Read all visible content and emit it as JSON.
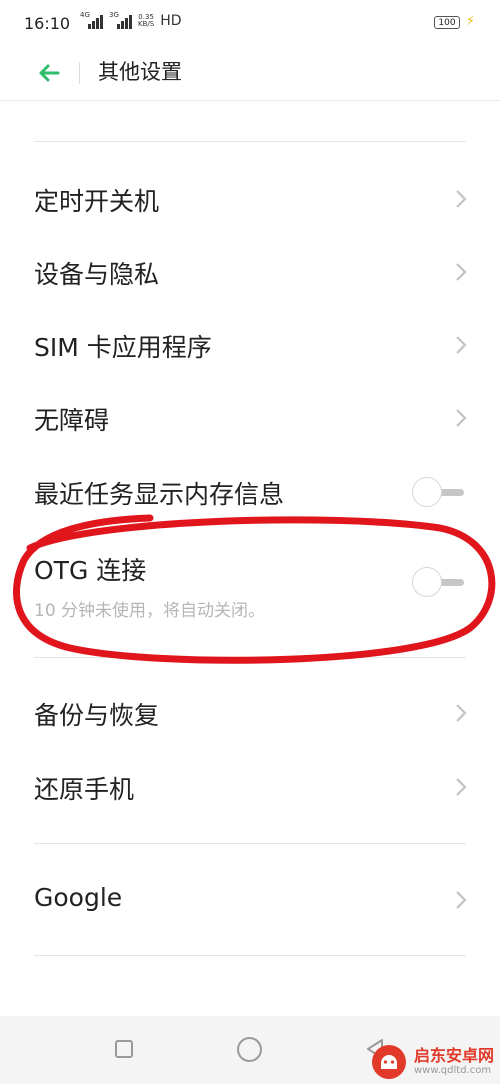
{
  "status_bar": {
    "time": "16:10",
    "signal1_label": "4G",
    "signal2_label": "3G",
    "speed_value": "0.35",
    "speed_unit": "KB/S",
    "hd": "HD",
    "battery": "100"
  },
  "header": {
    "title": "其他设置"
  },
  "settings": {
    "scheduled_power": "定时开关机",
    "device_privacy": "设备与隐私",
    "sim_apps": "SIM 卡应用程序",
    "accessibility": "无障碍",
    "recent_memory": {
      "label": "最近任务显示内存信息",
      "enabled": false
    },
    "otg": {
      "label": "OTG 连接",
      "subtitle": "10 分钟未使用，将自动关闭。",
      "enabled": false
    },
    "backup_restore": "备份与恢复",
    "reset_phone": "还原手机",
    "google": "Google"
  },
  "watermark": {
    "title": "启东安卓网",
    "url": "www.qdltd.com"
  },
  "colors": {
    "accent": "#2ebd6b",
    "annotation": "#e0161c"
  }
}
